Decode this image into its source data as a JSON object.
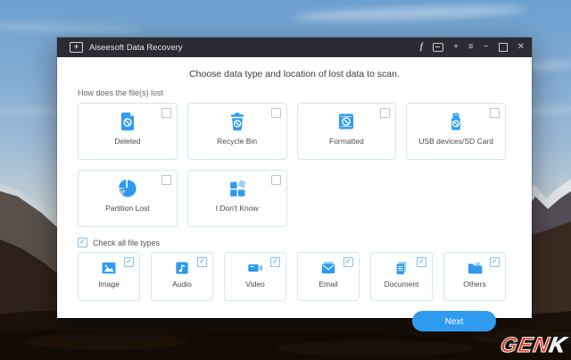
{
  "titlebar": {
    "title": "Aiseesoft Data Recovery",
    "icons": {
      "facebook": "f",
      "plus": "+",
      "menu": "≡",
      "minimize": "−",
      "close": "✕"
    }
  },
  "window": {
    "heading": "Choose data type and location of lost data to scan.",
    "next_label": "Next"
  },
  "scan": {
    "label": "How does the file(s) lost",
    "options": [
      {
        "label": "Deleted",
        "icon": "deleted-file-icon",
        "checked": false
      },
      {
        "label": "Recycle Bin",
        "icon": "recycle-bin-icon",
        "checked": false
      },
      {
        "label": "Formatted",
        "icon": "formatted-drive-icon",
        "checked": false
      },
      {
        "label": "USB devices/SD Card",
        "icon": "usb-drive-icon",
        "checked": false
      },
      {
        "label": "Partition Lost",
        "icon": "partition-pie-icon",
        "checked": false
      },
      {
        "label": "I Don't Know",
        "icon": "unknown-grid-icon",
        "checked": false
      }
    ]
  },
  "filetypes": {
    "check_all_label": "Check all file types",
    "check_all_checked": true,
    "types": [
      {
        "label": "Image",
        "icon": "image-icon",
        "checked": true
      },
      {
        "label": "Audio",
        "icon": "audio-icon",
        "checked": true
      },
      {
        "label": "Video",
        "icon": "video-icon",
        "checked": true
      },
      {
        "label": "Email",
        "icon": "email-icon",
        "checked": true
      },
      {
        "label": "Document",
        "icon": "document-icon",
        "checked": true
      },
      {
        "label": "Others",
        "icon": "others-folder-icon",
        "checked": true
      }
    ]
  },
  "watermark": {
    "red": "GEN",
    "white": "K"
  },
  "colors": {
    "accent": "#2e9bf0",
    "accent_light": "#9ed0f5",
    "titlebar": "#2b2b33",
    "card_border": "#cfe7f9"
  }
}
